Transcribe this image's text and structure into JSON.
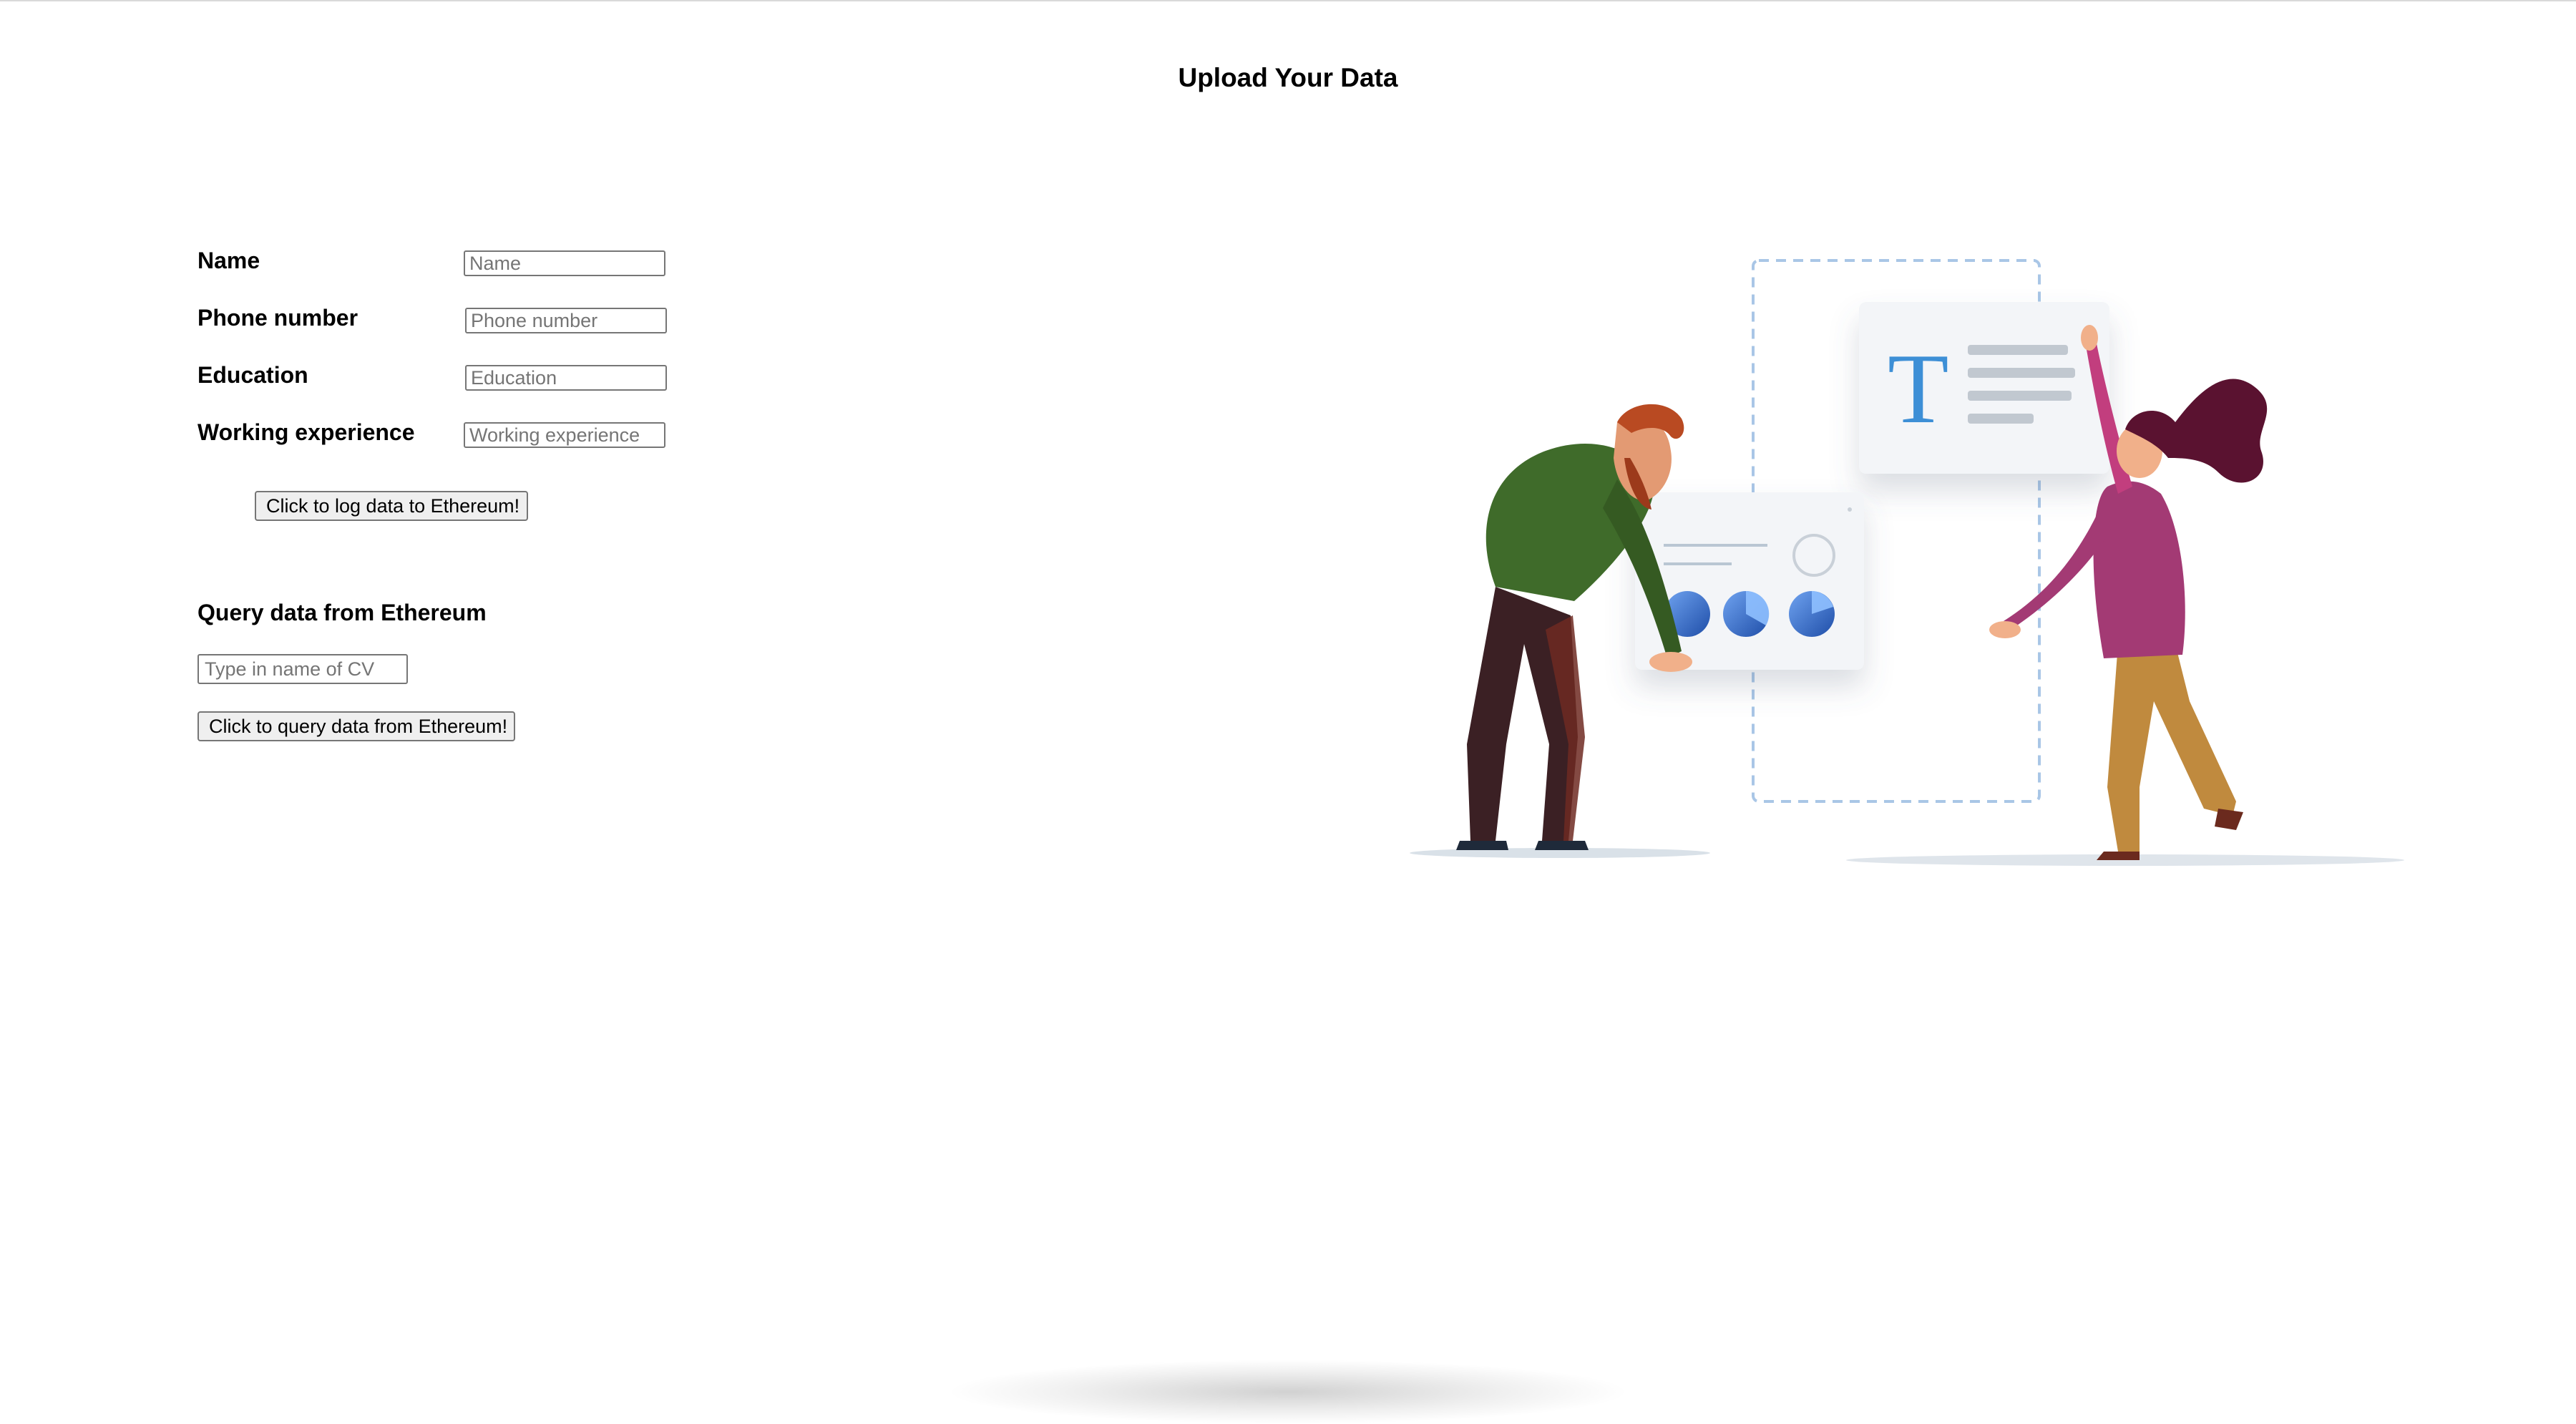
{
  "page": {
    "title": "Upload Your Data"
  },
  "form": {
    "fields": [
      {
        "label": "Name",
        "placeholder": "Name",
        "value": ""
      },
      {
        "label": "Phone number",
        "placeholder": "Phone number",
        "value": ""
      },
      {
        "label": "Education",
        "placeholder": "Education",
        "value": ""
      },
      {
        "label": "Working experience",
        "placeholder": "Working experience",
        "value": ""
      }
    ],
    "submit_label": "Click to log data to Ethereum!"
  },
  "query": {
    "title": "Query data from Ethereum",
    "placeholder": "Type in name of CV",
    "value": "",
    "button_label": "Click to query data from Ethereum!"
  },
  "illustration": {
    "text_card_glyph": "T",
    "colors": {
      "accent_blue": "#3a7bd5",
      "shirt_green": "#3f6b2a",
      "sweater_pink": "#a33a74",
      "pants_tan": "#c08a3e"
    }
  }
}
